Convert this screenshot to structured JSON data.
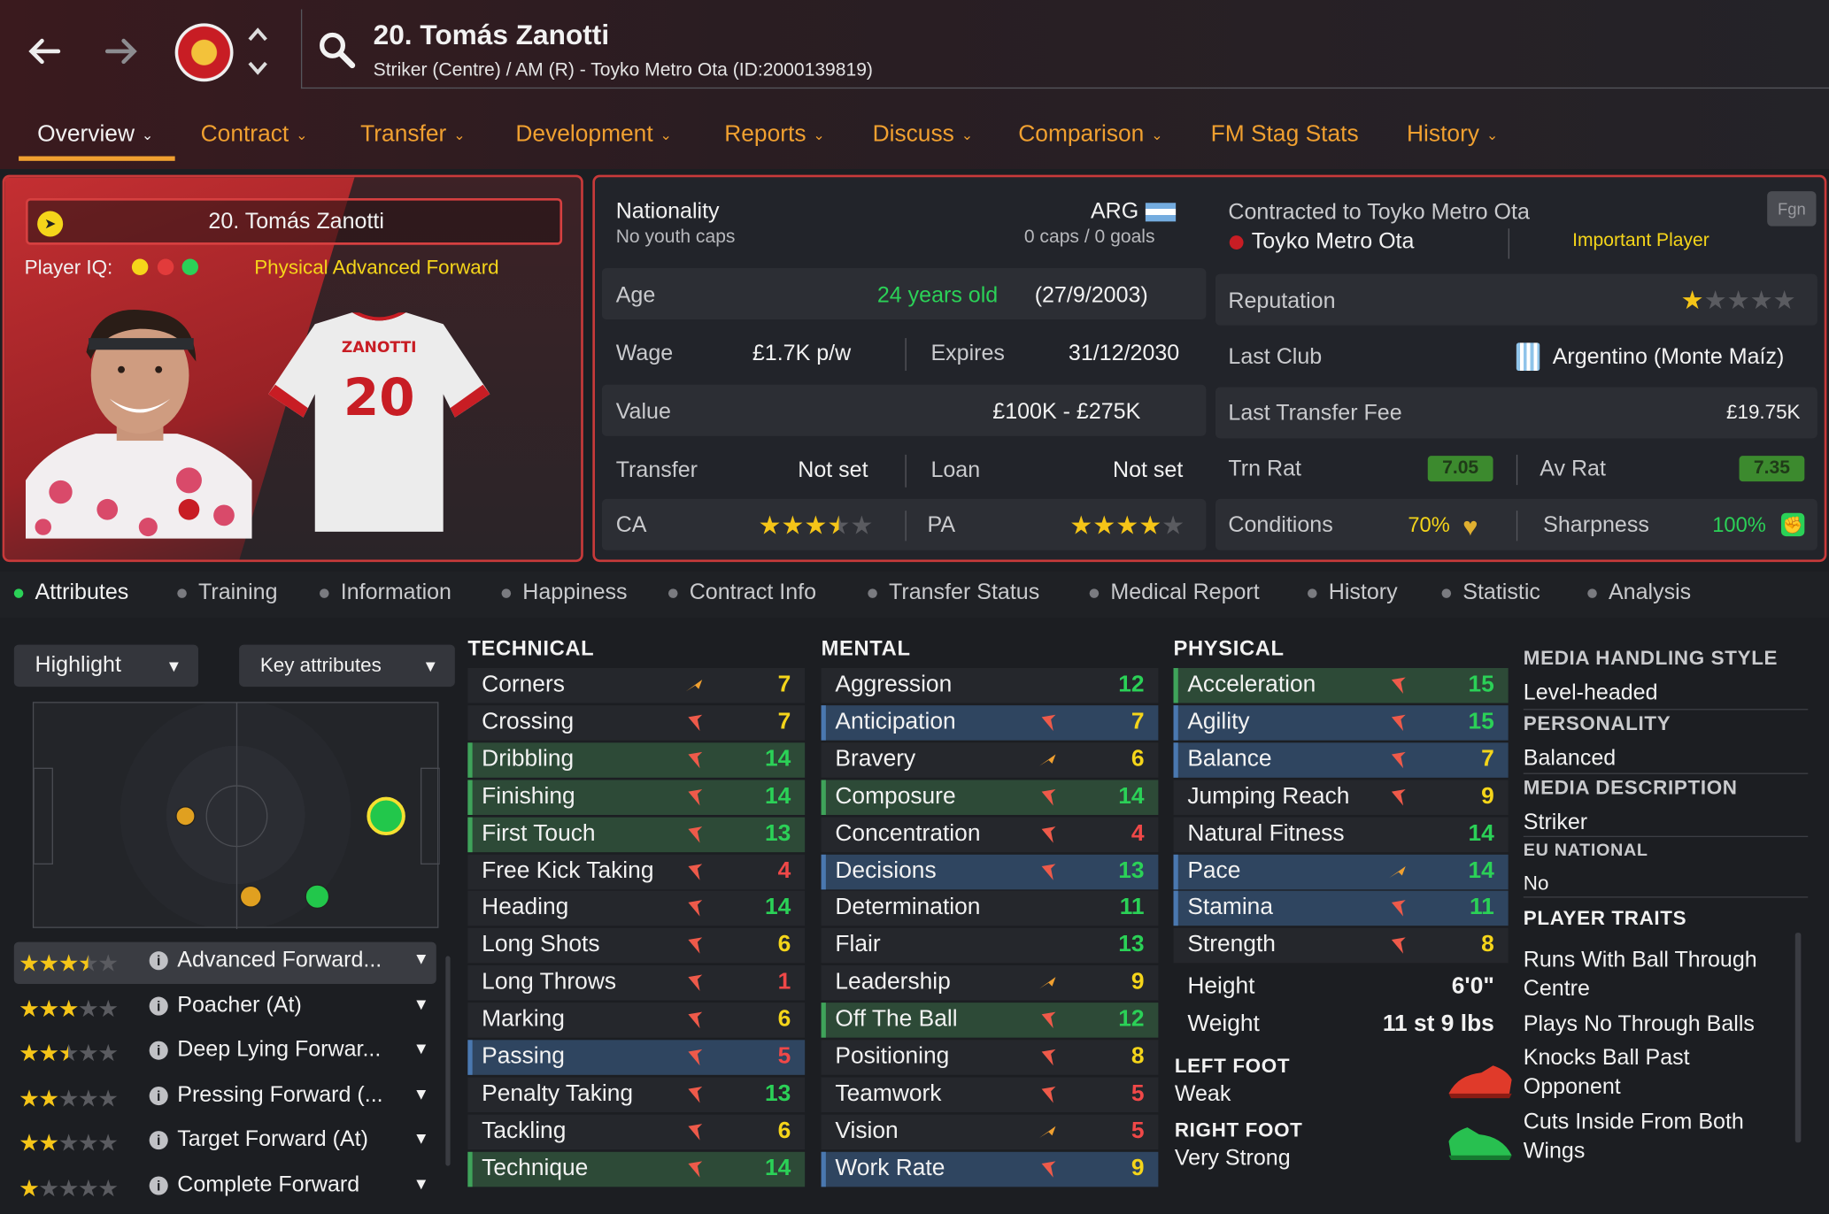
{
  "header": {
    "player_title": "20. Tomás Zanotti",
    "subtitle": "Striker (Centre) / AM (R) - Toyko Metro Ota (ID:2000139819)",
    "back_icon": "arrow-left-icon",
    "forward_icon": "arrow-right-icon",
    "search_icon": "search-icon",
    "club_crest": "club-crest-icon"
  },
  "tabs": [
    {
      "label": "Overview",
      "chevron": "⌄"
    },
    {
      "label": "Contract",
      "chevron": "⌄"
    },
    {
      "label": "Transfer",
      "chevron": "⌄"
    },
    {
      "label": "Development",
      "chevron": "⌄"
    },
    {
      "label": "Reports",
      "chevron": "⌄"
    },
    {
      "label": "Discuss",
      "chevron": "⌄"
    },
    {
      "label": "Comparison",
      "chevron": "⌄"
    },
    {
      "label": "FM Stag Stats",
      "chevron": ""
    },
    {
      "label": "History",
      "chevron": "⌄"
    }
  ],
  "profile": {
    "name": "20. Tomás Zanotti",
    "player_iq_label": "Player IQ:",
    "role": "Physical Advanced Forward",
    "shirt_name": "ZANOTTI",
    "shirt_number": "20",
    "iq_colors": [
      "#f5d51a",
      "#e23b3b",
      "#2bd157"
    ]
  },
  "info": {
    "nationality_label": "Nationality",
    "nationality_value": "ARG",
    "youth_caps": "No youth caps",
    "caps_goals": "0 caps / 0 goals",
    "age_label": "Age",
    "age_value": "24 years old",
    "dob": "(27/9/2003)",
    "wage_label": "Wage",
    "wage_value": "£1.7K p/w",
    "expires_label": "Expires",
    "expires_value": "31/12/2030",
    "value_label": "Value",
    "value_value": "£100K - £275K",
    "transfer_label": "Transfer",
    "transfer_value": "Not set",
    "loan_label": "Loan",
    "loan_value": "Not set",
    "ca_label": "CA",
    "ca_stars": 3.5,
    "pa_label": "PA",
    "pa_stars": 4
  },
  "club": {
    "contracted_label": "Contracted to Toyko Metro Ota",
    "club_name": "Toyko Metro Ota",
    "status": "Important Player",
    "fgn_button": "Fgn",
    "reputation_label": "Reputation",
    "reputation_stars": 1,
    "last_club_label": "Last Club",
    "last_club_value": "Argentino (Monte Maíz)",
    "last_fee_label": "Last Transfer Fee",
    "last_fee_value": "£19.75K",
    "trn_rat_label": "Trn Rat",
    "trn_rat_value": "7.05",
    "av_rat_label": "Av Rat",
    "av_rat_value": "7.35",
    "conditions_label": "Conditions",
    "conditions_value": "70%",
    "sharpness_label": "Sharpness",
    "sharpness_value": "100%"
  },
  "subtabs": [
    "Attributes",
    "Training",
    "Information",
    "Happiness",
    "Contract Info",
    "Transfer Status",
    "Medical Report",
    "History",
    "Statistic",
    "Analysis"
  ],
  "controls": {
    "highlight": "Highlight",
    "key_attributes": "Key attributes"
  },
  "roles": [
    {
      "stars": 3.5,
      "name": "Advanced Forward..."
    },
    {
      "stars": 3,
      "name": "Poacher (At)"
    },
    {
      "stars": 2.5,
      "name": "Deep Lying Forwar..."
    },
    {
      "stars": 2,
      "name": "Pressing Forward (..."
    },
    {
      "stars": 2,
      "name": "Target Forward (At)"
    },
    {
      "stars": 1,
      "name": "Complete Forward"
    }
  ],
  "technical": {
    "title": "TECHNICAL",
    "items": [
      {
        "name": "Corners",
        "value": "7",
        "hl": "plain",
        "arrow": "up",
        "vcolor": "#f5d51a"
      },
      {
        "name": "Crossing",
        "value": "7",
        "hl": "plain",
        "arrow": "down",
        "vcolor": "#f5d51a"
      },
      {
        "name": "Dribbling",
        "value": "14",
        "hl": "green",
        "arrow": "down",
        "vcolor": "#2bd157"
      },
      {
        "name": "Finishing",
        "value": "14",
        "hl": "green",
        "arrow": "down",
        "vcolor": "#2bd157"
      },
      {
        "name": "First Touch",
        "value": "13",
        "hl": "green",
        "arrow": "down",
        "vcolor": "#2bd157"
      },
      {
        "name": "Free Kick Taking",
        "value": "4",
        "hl": "plain",
        "arrow": "down",
        "vcolor": "#f04848"
      },
      {
        "name": "Heading",
        "value": "14",
        "hl": "plain",
        "arrow": "down",
        "vcolor": "#2bd157"
      },
      {
        "name": "Long Shots",
        "value": "6",
        "hl": "plain",
        "arrow": "down",
        "vcolor": "#f5d51a"
      },
      {
        "name": "Long Throws",
        "value": "1",
        "hl": "plain",
        "arrow": "down",
        "vcolor": "#f04848"
      },
      {
        "name": "Marking",
        "value": "6",
        "hl": "plain",
        "arrow": "down",
        "vcolor": "#f5d51a"
      },
      {
        "name": "Passing",
        "value": "5",
        "hl": "blue",
        "arrow": "down",
        "vcolor": "#f04848"
      },
      {
        "name": "Penalty Taking",
        "value": "13",
        "hl": "plain",
        "arrow": "down",
        "vcolor": "#2bd157"
      },
      {
        "name": "Tackling",
        "value": "6",
        "hl": "plain",
        "arrow": "down",
        "vcolor": "#f5d51a"
      },
      {
        "name": "Technique",
        "value": "14",
        "hl": "green",
        "arrow": "down",
        "vcolor": "#2bd157"
      }
    ]
  },
  "mental": {
    "title": "MENTAL",
    "items": [
      {
        "name": "Aggression",
        "value": "12",
        "hl": "plain",
        "arrow": "none",
        "vcolor": "#2bd157"
      },
      {
        "name": "Anticipation",
        "value": "7",
        "hl": "blue",
        "arrow": "down",
        "vcolor": "#f5d51a"
      },
      {
        "name": "Bravery",
        "value": "6",
        "hl": "plain",
        "arrow": "up",
        "vcolor": "#f5d51a"
      },
      {
        "name": "Composure",
        "value": "14",
        "hl": "green",
        "arrow": "down",
        "vcolor": "#2bd157"
      },
      {
        "name": "Concentration",
        "value": "4",
        "hl": "plain",
        "arrow": "down",
        "vcolor": "#f04848"
      },
      {
        "name": "Decisions",
        "value": "13",
        "hl": "blue",
        "arrow": "down",
        "vcolor": "#2bd157"
      },
      {
        "name": "Determination",
        "value": "11",
        "hl": "plain",
        "arrow": "none",
        "vcolor": "#2bd157"
      },
      {
        "name": "Flair",
        "value": "13",
        "hl": "plain",
        "arrow": "none",
        "vcolor": "#2bd157"
      },
      {
        "name": "Leadership",
        "value": "9",
        "hl": "plain",
        "arrow": "up",
        "vcolor": "#f5d51a"
      },
      {
        "name": "Off The Ball",
        "value": "12",
        "hl": "green",
        "arrow": "down",
        "vcolor": "#2bd157"
      },
      {
        "name": "Positioning",
        "value": "8",
        "hl": "plain",
        "arrow": "down",
        "vcolor": "#f5d51a"
      },
      {
        "name": "Teamwork",
        "value": "5",
        "hl": "plain",
        "arrow": "down",
        "vcolor": "#f04848"
      },
      {
        "name": "Vision",
        "value": "5",
        "hl": "plain",
        "arrow": "up",
        "vcolor": "#f04848"
      },
      {
        "name": "Work Rate",
        "value": "9",
        "hl": "blue",
        "arrow": "down",
        "vcolor": "#f5d51a"
      }
    ]
  },
  "physical": {
    "title": "PHYSICAL",
    "items": [
      {
        "name": "Acceleration",
        "value": "15",
        "hl": "green",
        "arrow": "down",
        "vcolor": "#2bd157"
      },
      {
        "name": "Agility",
        "value": "15",
        "hl": "blue",
        "arrow": "down",
        "vcolor": "#2bd157"
      },
      {
        "name": "Balance",
        "value": "7",
        "hl": "blue",
        "arrow": "down",
        "vcolor": "#f5d51a"
      },
      {
        "name": "Jumping Reach",
        "value": "9",
        "hl": "plain",
        "arrow": "down",
        "vcolor": "#f5d51a"
      },
      {
        "name": "Natural Fitness",
        "value": "14",
        "hl": "plain",
        "arrow": "none",
        "vcolor": "#2bd157"
      },
      {
        "name": "Pace",
        "value": "14",
        "hl": "blue",
        "arrow": "up",
        "vcolor": "#2bd157"
      },
      {
        "name": "Stamina",
        "value": "11",
        "hl": "blue",
        "arrow": "down",
        "vcolor": "#2bd157"
      },
      {
        "name": "Strength",
        "value": "8",
        "hl": "plain",
        "arrow": "down",
        "vcolor": "#f5d51a"
      }
    ],
    "height_label": "Height",
    "height_value": "6'0\"",
    "weight_label": "Weight",
    "weight_value": "11 st 9 lbs",
    "left_foot_label": "LEFT FOOT",
    "left_foot_value": "Weak",
    "right_foot_label": "RIGHT FOOT",
    "right_foot_value": "Very Strong"
  },
  "side": {
    "media_style_label": "MEDIA HANDLING STYLE",
    "media_style_value": "Level-headed",
    "personality_label": "PERSONALITY",
    "personality_value": "Balanced",
    "media_desc_label": "MEDIA DESCRIPTION",
    "media_desc_value": "Striker",
    "eu_label": "EU NATIONAL",
    "eu_value": "No",
    "traits_label": "PLAYER TRAITS",
    "traits": [
      "Runs With Ball Through Centre",
      "Plays No Through Balls",
      "Knocks Ball Past Opponent",
      "Cuts Inside From Both Wings"
    ]
  },
  "colors": {
    "accent_orange": "#f0a030",
    "border_red": "#c83a3a",
    "good": "#2bd157",
    "mid": "#f5d51a",
    "bad": "#f04848"
  }
}
